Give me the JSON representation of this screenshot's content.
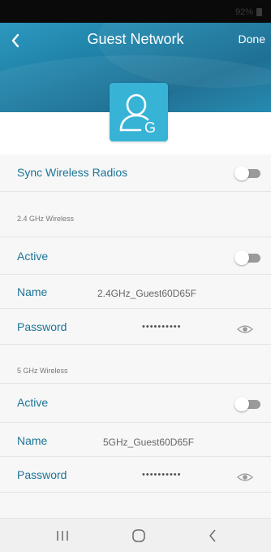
{
  "status_bar": {
    "battery": "92%"
  },
  "header": {
    "title": "Guest Network",
    "done_label": "Done",
    "avatar_letter": "G"
  },
  "sync": {
    "label": "Sync Wireless Radios",
    "enabled": false
  },
  "band_24": {
    "section_title": "2.4 GHz Wireless",
    "active_label": "Active",
    "active": false,
    "name_label": "Name",
    "name_value": "2.4GHz_Guest60D65F",
    "password_label": "Password",
    "password_masked": "••••••••••"
  },
  "band_5": {
    "section_title": "5 GHz Wireless",
    "active_label": "Active",
    "active": false,
    "name_label": "Name",
    "name_value": "5GHz_Guest60D65F",
    "password_label": "Password",
    "password_masked": "••••••••••"
  },
  "nav": {
    "items": [
      "recent-apps-icon",
      "home-icon",
      "back-icon"
    ]
  },
  "colors": {
    "accent": "#1b7497",
    "header": "#1d7fa5",
    "avatar": "#37b3d6",
    "toggle_off": "#9a9a9a"
  }
}
